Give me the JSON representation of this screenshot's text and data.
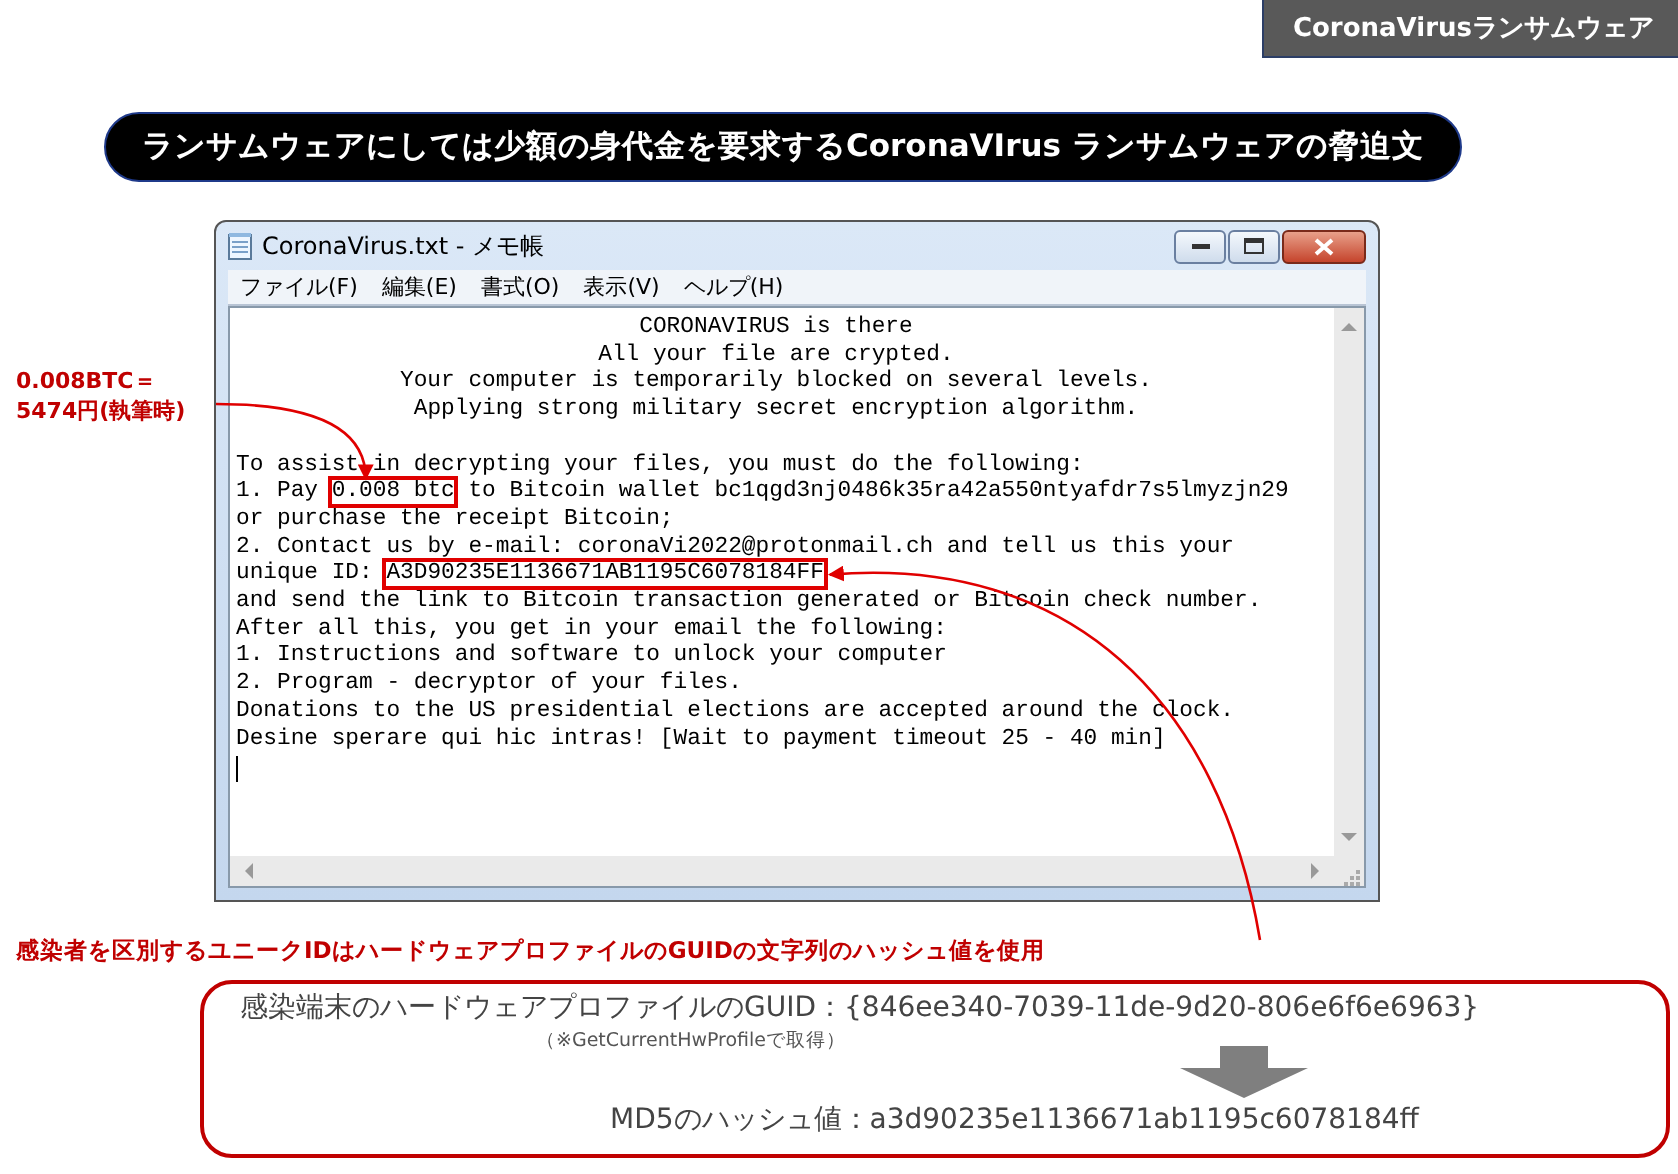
{
  "badge": "CoronaVirusランサムウェア",
  "headline": "ランサムウェアにしては少額の身代金を要求するCoronaVIrus ランサムウェアの脅迫文",
  "notepad": {
    "title": "CoronaVirus.txt - メモ帳",
    "menu": [
      "ファイル(F)",
      "編集(E)",
      "書式(O)",
      "表示(V)",
      "ヘルプ(H)"
    ],
    "lines": [
      {
        "kind": "centered",
        "parts": [
          {
            "text": "CORONAVIRUS is there",
            "highlighted": false
          }
        ]
      },
      {
        "kind": "centered",
        "parts": [
          {
            "text": "All your file are crypted.",
            "highlighted": false
          }
        ]
      },
      {
        "kind": "centered",
        "parts": [
          {
            "text": "Your computer is temporarily blocked on several levels.",
            "highlighted": false
          }
        ]
      },
      {
        "kind": "centered",
        "parts": [
          {
            "text": "Applying strong military secret encryption algorithm.",
            "highlighted": false
          }
        ]
      },
      {
        "kind": "blank"
      },
      {
        "kind": "left",
        "parts": [
          {
            "text": "To assist in decrypting your files, you must do the following:",
            "highlighted": false
          }
        ]
      },
      {
        "kind": "left",
        "parts": [
          {
            "text": "1. Pay ",
            "highlighted": false
          },
          {
            "text": "0.008 btc",
            "highlighted": true
          },
          {
            "text": " to Bitcoin wallet bc1qgd3nj0486k35ra42a550ntyafdr7s5lmyzjn29",
            "highlighted": false
          }
        ]
      },
      {
        "kind": "left",
        "parts": [
          {
            "text": "or purchase the receipt Bitcoin;",
            "highlighted": false
          }
        ]
      },
      {
        "kind": "left",
        "parts": [
          {
            "text": "2. Contact us by e-mail: coronaVi2022@protonmail.ch and tell us this your",
            "highlighted": false
          }
        ]
      },
      {
        "kind": "left",
        "parts": [
          {
            "text": "unique ID: ",
            "highlighted": false
          },
          {
            "text": "A3D90235E1136671AB1195C6078184FF",
            "highlighted": true
          }
        ]
      },
      {
        "kind": "left",
        "parts": [
          {
            "text": "and send the link to Bitcoin transaction generated or Bitcoin check number.",
            "highlighted": false
          }
        ]
      },
      {
        "kind": "left",
        "parts": [
          {
            "text": "After all this, you get in your email the following:",
            "highlighted": false
          }
        ]
      },
      {
        "kind": "left",
        "parts": [
          {
            "text": "1. Instructions and software to unlock your computer",
            "highlighted": false
          }
        ]
      },
      {
        "kind": "left",
        "parts": [
          {
            "text": "2. Program - decryptor of your files.",
            "highlighted": false
          }
        ]
      },
      {
        "kind": "left",
        "parts": [
          {
            "text": "Donations to the US presidential elections are accepted around the clock.",
            "highlighted": false
          }
        ]
      },
      {
        "kind": "left",
        "parts": [
          {
            "text": "Desine sperare qui hic intras! [Wait to payment timeout 25 - 40 min]",
            "highlighted": false
          }
        ]
      }
    ],
    "cursor": true
  },
  "price_note": [
    "0.008BTC＝",
    "5474円(執筆時)"
  ],
  "id_note": "感染者を区別するユニークIDはハードウェアプロファイルのGUIDの文字列のハッシュ値を使用",
  "hash_box": {
    "guid_line": "感染端末のハードウェアプロファイルのGUID：{846ee340-7039-11de-9d20-806e6f6e6963}",
    "source_note": "（※GetCurrentHwProfileで取得）",
    "md5_line": "MD5のハッシュ値：a3d90235e1136671ab1195c6078184ff"
  }
}
